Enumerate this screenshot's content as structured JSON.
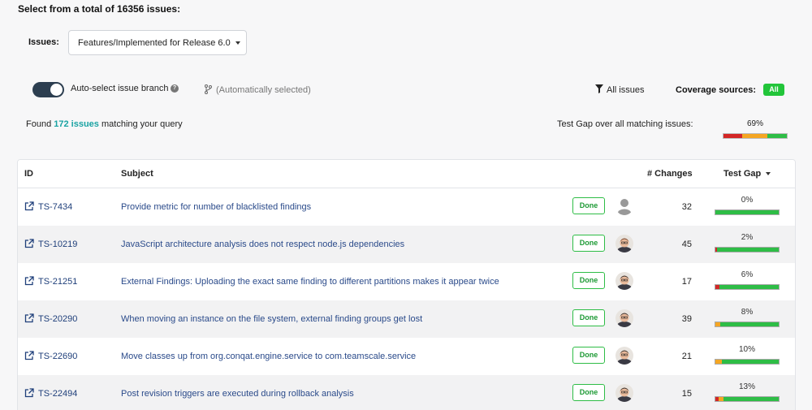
{
  "heading": "Select from a total of 16356 issues:",
  "issues": {
    "label": "Issues:",
    "selected": "Features/Implemented for Release 6.0"
  },
  "toolbar": {
    "auto_select_label": "Auto-select issue branch",
    "auto_select_on": true,
    "auto_selected_text": "(Automatically selected)",
    "all_issues": "All issues",
    "coverage_label": "Coverage sources:",
    "coverage_badge": "All"
  },
  "summary": {
    "found_prefix": "Found",
    "found_count": "172 issues",
    "found_suffix": "matching your query",
    "test_gap_label": "Test Gap over all matching issues:",
    "test_gap_pct": "69%",
    "test_gap_bar": {
      "red": 0.3,
      "orange": 0.39,
      "green": 0.31
    }
  },
  "table": {
    "headers": {
      "id": "ID",
      "subject": "Subject",
      "changes": "# Changes",
      "test_gap": "Test Gap"
    },
    "rows": [
      {
        "id": "TS-7434",
        "subject": "Provide metric for number of blacklisted findings",
        "status": "Done",
        "avatar": "default-user",
        "changes": "32",
        "pct": "0%",
        "bar": {
          "red": 0,
          "orange": 0,
          "green": 1
        }
      },
      {
        "id": "TS-10219",
        "subject": "JavaScript architecture analysis does not respect node.js dependencies",
        "status": "Done",
        "avatar": "user-photo",
        "changes": "45",
        "pct": "2%",
        "bar": {
          "red": 0.02,
          "orange": 0,
          "green": 0.98
        }
      },
      {
        "id": "TS-21251",
        "subject": "External Findings: Uploading the exact same finding to different partitions makes it appear twice",
        "status": "Done",
        "avatar": "user-photo",
        "changes": "17",
        "pct": "6%",
        "bar": {
          "red": 0.06,
          "orange": 0,
          "green": 0.94
        }
      },
      {
        "id": "TS-20290",
        "subject": "When moving an instance on the file system, external finding groups get lost",
        "status": "Done",
        "avatar": "user-photo",
        "changes": "39",
        "pct": "8%",
        "bar": {
          "red": 0,
          "orange": 0.08,
          "green": 0.92
        }
      },
      {
        "id": "TS-22690",
        "subject": "Move classes up from org.conqat.engine.service to com.teamscale.service",
        "status": "Done",
        "avatar": "user-photo",
        "changes": "21",
        "pct": "10%",
        "bar": {
          "red": 0,
          "orange": 0.1,
          "green": 0.9
        }
      },
      {
        "id": "TS-22494",
        "subject": "Post revision triggers are executed during rollback analysis",
        "status": "Done",
        "avatar": "user-photo",
        "changes": "15",
        "pct": "13%",
        "bar": {
          "red": 0.05,
          "orange": 0.08,
          "green": 0.87
        }
      }
    ]
  },
  "colors": {
    "red": "#d32626",
    "orange": "#f5a623",
    "green": "#2ebd46",
    "link": "#2a4a8a",
    "teal": "#1aa3a3"
  }
}
